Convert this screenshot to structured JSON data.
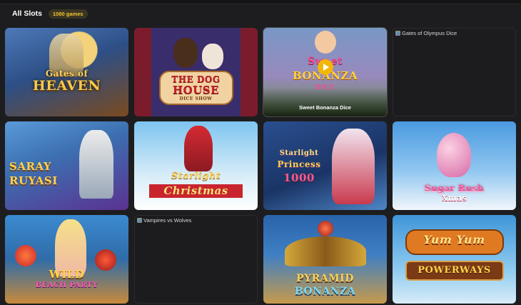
{
  "header": {
    "title": "All Slots",
    "count_badge": "1080 games"
  },
  "games": [
    {
      "logo_line1": "Gates of",
      "logo_line2": "HEAVEN",
      "colors": [
        "#3a5a8c",
        "#c9822a"
      ]
    },
    {
      "logo_line1": "THE DOG",
      "logo_line2": "HOUSE",
      "logo_sub": "DICE SHOW",
      "colors": [
        "#6a1a3a",
        "#2a2450"
      ]
    },
    {
      "logo_line1": "Sweet",
      "logo_line2": "BONANZA",
      "logo_sub": "DICE",
      "caption": "Sweet Bonanza Dice",
      "colors": [
        "#7aa6e8",
        "#c774c0"
      ]
    },
    {
      "broken_alt": "Gates of Olympus Dice"
    },
    {
      "logo_line1": "SARAY",
      "logo_line2": "RUYASI",
      "colors": [
        "#3a7bb5",
        "#6f3e9c"
      ]
    },
    {
      "logo_line1": "Starlight",
      "logo_line2": "Christmas",
      "colors": [
        "#2d8cc9",
        "#c93a3a"
      ]
    },
    {
      "logo_line1": "Starlight",
      "logo_line2": "Princess",
      "logo_sub": "1000",
      "colors": [
        "#1d3e78",
        "#3a7ac9"
      ]
    },
    {
      "logo_line1": "Sugar Rush",
      "logo_line2": "Xmas",
      "colors": [
        "#2d79c9",
        "#d94b8a"
      ]
    },
    {
      "logo_line1": "WILD",
      "logo_line2": "BEACH PARTY",
      "colors": [
        "#1a6fb0",
        "#e8a03c"
      ]
    },
    {
      "broken_alt": "Vampires vs Wolves"
    },
    {
      "logo_line1": "PYRAMID",
      "logo_line2": "BONANZA",
      "colors": [
        "#2a6bb0",
        "#b8862a"
      ]
    },
    {
      "logo_line1": "Yum Yum",
      "logo_line2": "POWERWAYS",
      "colors": [
        "#2f86c9",
        "#7dbde8"
      ]
    }
  ]
}
